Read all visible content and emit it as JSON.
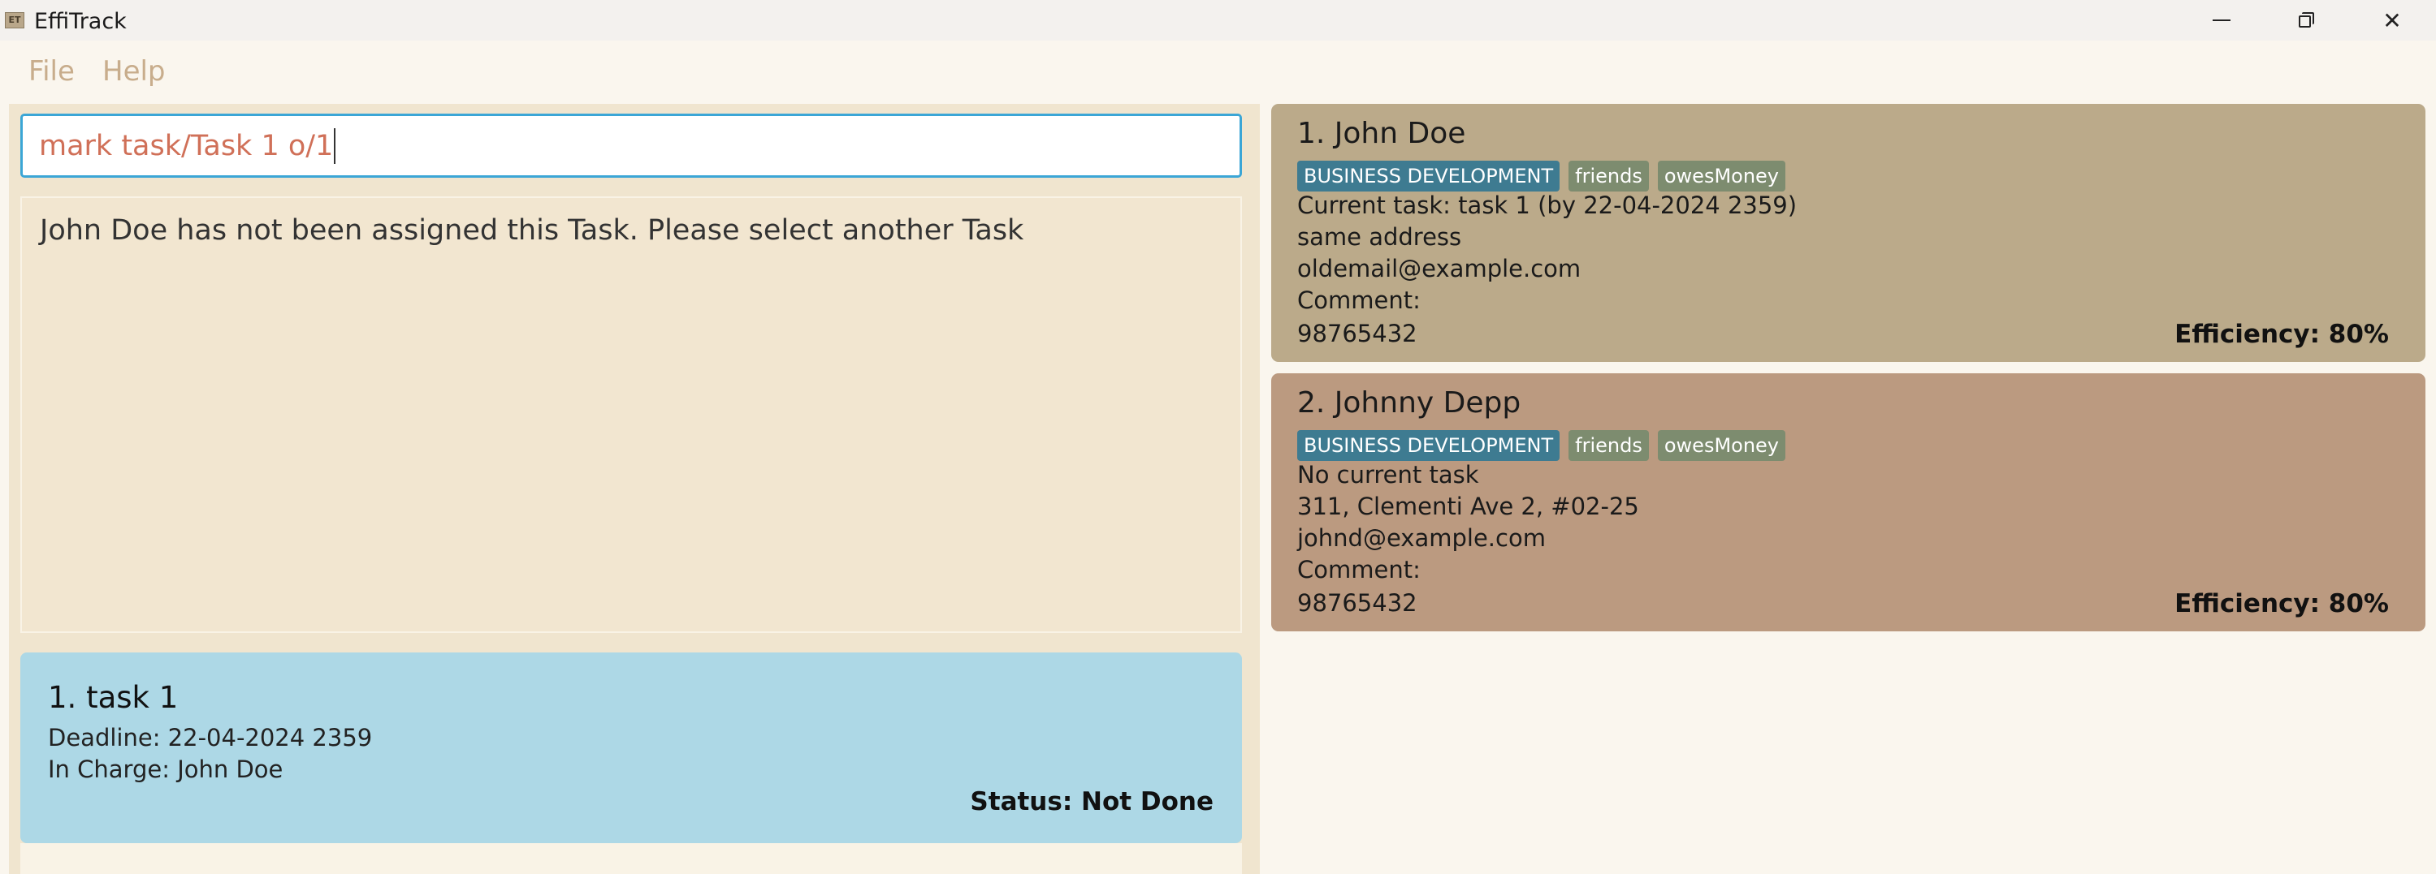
{
  "window": {
    "title": "EffiTrack",
    "icon_text": "ET"
  },
  "menu": {
    "file": "File",
    "help": "Help"
  },
  "command": {
    "value": "mark task/Task 1 o/1"
  },
  "result": {
    "message": "John Doe has not been assigned this Task. Please select another Task"
  },
  "tasks": [
    {
      "title": "1.  task 1",
      "deadline": "Deadline: 22-04-2024 2359",
      "in_charge": "In Charge: John Doe",
      "status": "Status: Not Done"
    }
  ],
  "persons": [
    {
      "name": "1.  John Doe",
      "tags": [
        "BUSINESS DEVELOPMENT",
        "friends",
        "owesMoney"
      ],
      "task": "Current task: task 1 (by 22-04-2024 2359)",
      "address": "same address",
      "email": "oldemail@example.com",
      "comment": "Comment:",
      "phone": "98765432",
      "efficiency": "Efficiency: 80%"
    },
    {
      "name": "2.  Johnny Depp",
      "tags": [
        "BUSINESS DEVELOPMENT",
        "friends",
        "owesMoney"
      ],
      "task": "No current task",
      "address": "311, Clementi Ave 2, #02-25",
      "email": "johnd@example.com",
      "comment": "Comment:",
      "phone": "98765432",
      "efficiency": "Efficiency: 80%"
    }
  ],
  "colors": {
    "accent_input_border": "#3ba6d6",
    "task_card": "#add8e6",
    "person_card_1": "#bbaa8a",
    "person_card_2": "#bb9a80",
    "tag_department": "#3e7b91",
    "tag_default": "#7d8c6f"
  }
}
